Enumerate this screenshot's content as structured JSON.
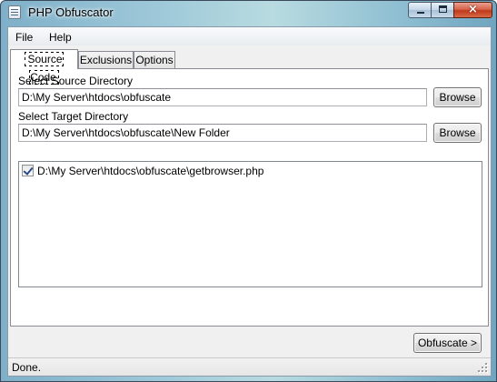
{
  "window": {
    "title": "PHP Obfuscator",
    "close_glyph": "×"
  },
  "menu": {
    "file": "File",
    "help": "Help"
  },
  "tabs": [
    {
      "label": "Source Code",
      "active": true
    },
    {
      "label": "Exclusions",
      "active": false
    },
    {
      "label": "Options",
      "active": false
    }
  ],
  "source": {
    "label": "Select Source Directory",
    "value": "D:\\My Server\\htdocs\\obfuscate",
    "browse_label": "Browse"
  },
  "target": {
    "label": "Select Target Directory",
    "value": "D:\\My Server\\htdocs\\obfuscate\\New Folder",
    "browse_label": "Browse"
  },
  "files": [
    {
      "path": "D:\\My Server\\htdocs\\obfuscate\\getbrowser.php",
      "checked": true
    }
  ],
  "actions": {
    "obfuscate_label": "Obfuscate >"
  },
  "status": {
    "text": "Done."
  },
  "icons": {
    "app": "document-icon",
    "minimize": "minimize-icon",
    "maximize": "maximize-icon",
    "close": "close-icon",
    "checkbox": "checkbox-checked-icon",
    "grip": "resize-grip-icon"
  }
}
